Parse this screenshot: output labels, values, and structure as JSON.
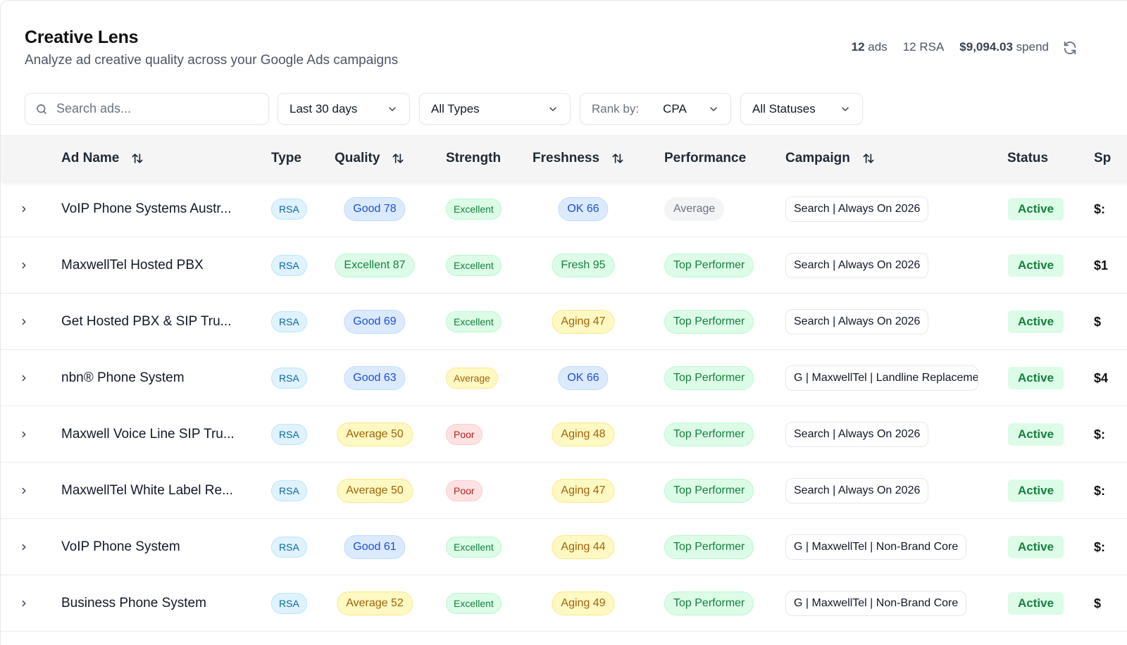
{
  "header": {
    "title": "Creative Lens",
    "subtitle": "Analyze ad creative quality across your Google Ads campaigns"
  },
  "stats": {
    "ads_count": "12",
    "ads_label": "ads",
    "rsa_label": "12 RSA",
    "spend_value": "$9,094.03",
    "spend_label": "spend"
  },
  "filters": {
    "search_placeholder": "Search ads...",
    "date_range": "Last 30 days",
    "type": "All Types",
    "rank_label": "Rank by:",
    "rank_value": "CPA",
    "status": "All Statuses"
  },
  "table": {
    "columns": {
      "ad_name": "Ad Name",
      "type": "Type",
      "quality": "Quality",
      "strength": "Strength",
      "freshness": "Freshness",
      "performance": "Performance",
      "campaign": "Campaign",
      "status": "Status",
      "spend": "Sp"
    },
    "rows": [
      {
        "name": "VoIP Phone Systems Austr...",
        "type": "RSA",
        "quality": "Good 78",
        "strength": "Excellent",
        "freshness": "OK 66",
        "performance": "Average",
        "campaign": "Search | Always On 2026",
        "status": "Active",
        "spend": "$:"
      },
      {
        "name": "MaxwellTel Hosted PBX",
        "type": "RSA",
        "quality": "Excellent 87",
        "strength": "Excellent",
        "freshness": "Fresh 95",
        "performance": "Top Performer",
        "campaign": "Search | Always On 2026",
        "status": "Active",
        "spend": "$1"
      },
      {
        "name": "Get Hosted PBX & SIP Tru...",
        "type": "RSA",
        "quality": "Good 69",
        "strength": "Excellent",
        "freshness": "Aging 47",
        "performance": "Top Performer",
        "campaign": "Search | Always On 2026",
        "status": "Active",
        "spend": "$"
      },
      {
        "name": "nbn® Phone System",
        "type": "RSA",
        "quality": "Good 63",
        "strength": "Average",
        "freshness": "OK 66",
        "performance": "Top Performer",
        "campaign": "G | MaxwellTel | Landline Replaceme",
        "status": "Active",
        "spend": "$4"
      },
      {
        "name": "Maxwell Voice Line SIP Tru...",
        "type": "RSA",
        "quality": "Average 50",
        "strength": "Poor",
        "freshness": "Aging 48",
        "performance": "Top Performer",
        "campaign": "Search | Always On 2026",
        "status": "Active",
        "spend": "$:"
      },
      {
        "name": "MaxwellTel White Label Re...",
        "type": "RSA",
        "quality": "Average 50",
        "strength": "Poor",
        "freshness": "Aging 47",
        "performance": "Top Performer",
        "campaign": "Search | Always On 2026",
        "status": "Active",
        "spend": "$:"
      },
      {
        "name": "VoIP Phone System",
        "type": "RSA",
        "quality": "Good 61",
        "strength": "Excellent",
        "freshness": "Aging 44",
        "performance": "Top Performer",
        "campaign": "G | MaxwellTel | Non-Brand Core",
        "status": "Active",
        "spend": "$:"
      },
      {
        "name": "Business Phone System",
        "type": "RSA",
        "quality": "Average 52",
        "strength": "Excellent",
        "freshness": "Aging 49",
        "performance": "Top Performer",
        "campaign": "G | MaxwellTel | Non-Brand Core",
        "status": "Active",
        "spend": "$"
      }
    ]
  },
  "colors": {
    "blue": {
      "bg": "#dbeafe",
      "border": "#bfdbfe",
      "text": "#1d4ed8"
    },
    "sky": {
      "bg": "#e0f2fe",
      "border": "#bae6fd",
      "text": "#0369a1"
    },
    "green": {
      "bg": "#dcfce7",
      "border": "#bbf7d0",
      "text": "#15803d"
    },
    "yellow": {
      "bg": "#fef9c3",
      "border": "#fde68a",
      "text": "#a16207"
    },
    "red": {
      "bg": "#fee2e2",
      "border": "#fecaca",
      "text": "#b91c1c"
    },
    "gray": {
      "bg": "#f3f4f6",
      "border": "#f3f4f6",
      "text": "#6b7280"
    }
  },
  "icons": {
    "search": "search-icon",
    "chevron": "chevron-down-icon",
    "sort": "sort-icon",
    "refresh": "refresh-icon",
    "expand": "chevron-right-icon"
  }
}
